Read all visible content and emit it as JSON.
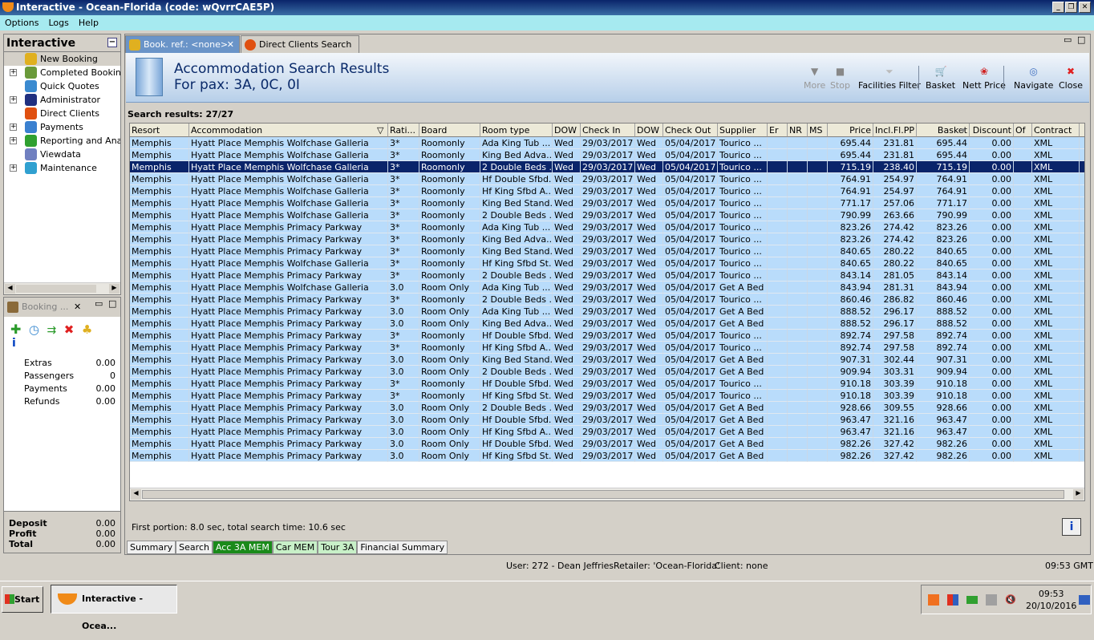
{
  "window": {
    "title": "Interactive - Ocean-Florida (code: wQvrrCAE5P)"
  },
  "menu": [
    "Options",
    "Logs",
    "Help"
  ],
  "sidebar": {
    "title": "Interactive",
    "items": [
      {
        "label": "New Booking",
        "expandable": false,
        "icon": "palm-tree-icon",
        "color": "#e0b020"
      },
      {
        "label": "Completed Bookings",
        "expandable": true,
        "icon": "palm-money-icon",
        "color": "#6a9a3a"
      },
      {
        "label": "Quick Quotes",
        "expandable": false,
        "icon": "clock-icon",
        "color": "#3a8ad0"
      },
      {
        "label": "Administrator",
        "expandable": true,
        "icon": "runner-icon",
        "color": "#203080"
      },
      {
        "label": "Direct Clients",
        "expandable": false,
        "icon": "client-icon",
        "color": "#e05010"
      },
      {
        "label": "Payments",
        "expandable": true,
        "icon": "payment-card-icon",
        "color": "#3a80d0"
      },
      {
        "label": "Reporting and Analyt",
        "expandable": true,
        "icon": "report-icon",
        "color": "#30a030"
      },
      {
        "label": "Viewdata",
        "expandable": false,
        "icon": "globe-icon",
        "color": "#7080c0"
      },
      {
        "label": "Maintenance",
        "expandable": true,
        "icon": "toolbox-icon",
        "color": "#30a0d0"
      }
    ]
  },
  "booking": {
    "title": "Booking ...",
    "info": "i",
    "items": [
      {
        "label": "Extras",
        "value": "0.00"
      },
      {
        "label": "Passengers",
        "value": "0"
      },
      {
        "label": "Payments",
        "value": "0.00"
      },
      {
        "label": "Refunds",
        "value": "0.00"
      }
    ],
    "totals": [
      {
        "label": "Deposit",
        "value": "0.00"
      },
      {
        "label": "Profit",
        "value": "0.00"
      },
      {
        "label": "Total",
        "value": "0.00"
      }
    ]
  },
  "tabs": [
    {
      "label": "Book. ref.: <none>",
      "active": true
    },
    {
      "label": "Direct Clients Search",
      "active": false
    }
  ],
  "header": {
    "title": "Accommodation Search Results",
    "subtitle": "For pax: 3A, 0C, 0I"
  },
  "toolbar": [
    {
      "label": "More",
      "disabled": true,
      "icon": "triangle-down-icon"
    },
    {
      "label": "Stop",
      "disabled": true,
      "icon": "stop-icon"
    },
    {
      "label": "Facilities Filter",
      "disabled": false,
      "icon": "funnel-icon"
    },
    {
      "label": "Basket",
      "disabled": false,
      "icon": "basket-icon"
    },
    {
      "label": "Nett Price",
      "disabled": false,
      "icon": "nett-price-icon"
    },
    {
      "label": "Navigate",
      "disabled": false,
      "icon": "compass-icon"
    },
    {
      "label": "Close",
      "disabled": false,
      "icon": "close-x-icon"
    }
  ],
  "results_label": "Search results: 27/27",
  "columns": [
    "Resort",
    "Accommodation",
    "Rati...",
    "Board",
    "Room type",
    "DOW",
    "Check In",
    "DOW",
    "Check Out",
    "Supplier",
    "Er",
    "NR",
    "MS",
    "Price",
    "Incl.Fl.PP",
    "Basket",
    "Discount",
    "Of",
    "Contract"
  ],
  "rows": [
    [
      "Memphis",
      "Hyatt Place Memphis Wolfchase Galleria",
      "3*",
      "Roomonly",
      "Ada King Tub ...",
      "Wed",
      "29/03/2017",
      "Wed",
      "05/04/2017",
      "Tourico ...",
      "",
      "",
      "",
      "695.44",
      "231.81",
      "695.44",
      "0.00",
      "",
      "XML"
    ],
    [
      "Memphis",
      "Hyatt Place Memphis Wolfchase Galleria",
      "3*",
      "Roomonly",
      "King Bed Adva...",
      "Wed",
      "29/03/2017",
      "Wed",
      "05/04/2017",
      "Tourico ...",
      "",
      "",
      "",
      "695.44",
      "231.81",
      "695.44",
      "0.00",
      "",
      "XML"
    ],
    [
      "Memphis",
      "Hyatt Place Memphis Wolfchase Galleria",
      "3*",
      "Roomonly",
      "2 Double Beds ...",
      "Wed",
      "29/03/2017",
      "Wed",
      "05/04/2017",
      "Tourico ...",
      "",
      "",
      "",
      "715.19",
      "238.40",
      "715.19",
      "0.00",
      "",
      "XML"
    ],
    [
      "Memphis",
      "Hyatt Place Memphis Wolfchase Galleria",
      "3*",
      "Roomonly",
      "Hf Double Sfbd...",
      "Wed",
      "29/03/2017",
      "Wed",
      "05/04/2017",
      "Tourico ...",
      "",
      "",
      "",
      "764.91",
      "254.97",
      "764.91",
      "0.00",
      "",
      "XML"
    ],
    [
      "Memphis",
      "Hyatt Place Memphis Wolfchase Galleria",
      "3*",
      "Roomonly",
      "Hf King Sfbd A...",
      "Wed",
      "29/03/2017",
      "Wed",
      "05/04/2017",
      "Tourico ...",
      "",
      "",
      "",
      "764.91",
      "254.97",
      "764.91",
      "0.00",
      "",
      "XML"
    ],
    [
      "Memphis",
      "Hyatt Place Memphis Wolfchase Galleria",
      "3*",
      "Roomonly",
      "King Bed Stand...",
      "Wed",
      "29/03/2017",
      "Wed",
      "05/04/2017",
      "Tourico ...",
      "",
      "",
      "",
      "771.17",
      "257.06",
      "771.17",
      "0.00",
      "",
      "XML"
    ],
    [
      "Memphis",
      "Hyatt Place Memphis Wolfchase Galleria",
      "3*",
      "Roomonly",
      "2 Double Beds ...",
      "Wed",
      "29/03/2017",
      "Wed",
      "05/04/2017",
      "Tourico ...",
      "",
      "",
      "",
      "790.99",
      "263.66",
      "790.99",
      "0.00",
      "",
      "XML"
    ],
    [
      "Memphis",
      "Hyatt Place Memphis Primacy Parkway",
      "3*",
      "Roomonly",
      "Ada King Tub ...",
      "Wed",
      "29/03/2017",
      "Wed",
      "05/04/2017",
      "Tourico ...",
      "",
      "",
      "",
      "823.26",
      "274.42",
      "823.26",
      "0.00",
      "",
      "XML"
    ],
    [
      "Memphis",
      "Hyatt Place Memphis Primacy Parkway",
      "3*",
      "Roomonly",
      "King Bed Adva...",
      "Wed",
      "29/03/2017",
      "Wed",
      "05/04/2017",
      "Tourico ...",
      "",
      "",
      "",
      "823.26",
      "274.42",
      "823.26",
      "0.00",
      "",
      "XML"
    ],
    [
      "Memphis",
      "Hyatt Place Memphis Primacy Parkway",
      "3*",
      "Roomonly",
      "King Bed Stand...",
      "Wed",
      "29/03/2017",
      "Wed",
      "05/04/2017",
      "Tourico ...",
      "",
      "",
      "",
      "840.65",
      "280.22",
      "840.65",
      "0.00",
      "",
      "XML"
    ],
    [
      "Memphis",
      "Hyatt Place Memphis Wolfchase Galleria",
      "3*",
      "Roomonly",
      "Hf King Sfbd St...",
      "Wed",
      "29/03/2017",
      "Wed",
      "05/04/2017",
      "Tourico ...",
      "",
      "",
      "",
      "840.65",
      "280.22",
      "840.65",
      "0.00",
      "",
      "XML"
    ],
    [
      "Memphis",
      "Hyatt Place Memphis Primacy Parkway",
      "3*",
      "Roomonly",
      "2 Double Beds ...",
      "Wed",
      "29/03/2017",
      "Wed",
      "05/04/2017",
      "Tourico ...",
      "",
      "",
      "",
      "843.14",
      "281.05",
      "843.14",
      "0.00",
      "",
      "XML"
    ],
    [
      "Memphis",
      "Hyatt Place Memphis Wolfchase Galleria",
      "3.0",
      "Room Only",
      "Ada King Tub ...",
      "Wed",
      "29/03/2017",
      "Wed",
      "05/04/2017",
      "Get A Bed",
      "",
      "",
      "",
      "843.94",
      "281.31",
      "843.94",
      "0.00",
      "",
      "XML"
    ],
    [
      "Memphis",
      "Hyatt Place Memphis Primacy Parkway",
      "3*",
      "Roomonly",
      "2 Double Beds ...",
      "Wed",
      "29/03/2017",
      "Wed",
      "05/04/2017",
      "Tourico ...",
      "",
      "",
      "",
      "860.46",
      "286.82",
      "860.46",
      "0.00",
      "",
      "XML"
    ],
    [
      "Memphis",
      "Hyatt Place Memphis Primacy Parkway",
      "3.0",
      "Room Only",
      "Ada King Tub ...",
      "Wed",
      "29/03/2017",
      "Wed",
      "05/04/2017",
      "Get A Bed",
      "",
      "",
      "",
      "888.52",
      "296.17",
      "888.52",
      "0.00",
      "",
      "XML"
    ],
    [
      "Memphis",
      "Hyatt Place Memphis Primacy Parkway",
      "3.0",
      "Room Only",
      "King Bed Adva...",
      "Wed",
      "29/03/2017",
      "Wed",
      "05/04/2017",
      "Get A Bed",
      "",
      "",
      "",
      "888.52",
      "296.17",
      "888.52",
      "0.00",
      "",
      "XML"
    ],
    [
      "Memphis",
      "Hyatt Place Memphis Primacy Parkway",
      "3*",
      "Roomonly",
      "Hf Double Sfbd...",
      "Wed",
      "29/03/2017",
      "Wed",
      "05/04/2017",
      "Tourico ...",
      "",
      "",
      "",
      "892.74",
      "297.58",
      "892.74",
      "0.00",
      "",
      "XML"
    ],
    [
      "Memphis",
      "Hyatt Place Memphis Primacy Parkway",
      "3*",
      "Roomonly",
      "Hf King Sfbd A...",
      "Wed",
      "29/03/2017",
      "Wed",
      "05/04/2017",
      "Tourico ...",
      "",
      "",
      "",
      "892.74",
      "297.58",
      "892.74",
      "0.00",
      "",
      "XML"
    ],
    [
      "Memphis",
      "Hyatt Place Memphis Primacy Parkway",
      "3.0",
      "Room Only",
      "King Bed Stand...",
      "Wed",
      "29/03/2017",
      "Wed",
      "05/04/2017",
      "Get A Bed",
      "",
      "",
      "",
      "907.31",
      "302.44",
      "907.31",
      "0.00",
      "",
      "XML"
    ],
    [
      "Memphis",
      "Hyatt Place Memphis Primacy Parkway",
      "3.0",
      "Room Only",
      "2 Double Beds ...",
      "Wed",
      "29/03/2017",
      "Wed",
      "05/04/2017",
      "Get A Bed",
      "",
      "",
      "",
      "909.94",
      "303.31",
      "909.94",
      "0.00",
      "",
      "XML"
    ],
    [
      "Memphis",
      "Hyatt Place Memphis Primacy Parkway",
      "3*",
      "Roomonly",
      "Hf Double Sfbd...",
      "Wed",
      "29/03/2017",
      "Wed",
      "05/04/2017",
      "Tourico ...",
      "",
      "",
      "",
      "910.18",
      "303.39",
      "910.18",
      "0.00",
      "",
      "XML"
    ],
    [
      "Memphis",
      "Hyatt Place Memphis Primacy Parkway",
      "3*",
      "Roomonly",
      "Hf King Sfbd St...",
      "Wed",
      "29/03/2017",
      "Wed",
      "05/04/2017",
      "Tourico ...",
      "",
      "",
      "",
      "910.18",
      "303.39",
      "910.18",
      "0.00",
      "",
      "XML"
    ],
    [
      "Memphis",
      "Hyatt Place Memphis Primacy Parkway",
      "3.0",
      "Room Only",
      "2 Double Beds ...",
      "Wed",
      "29/03/2017",
      "Wed",
      "05/04/2017",
      "Get A Bed",
      "",
      "",
      "",
      "928.66",
      "309.55",
      "928.66",
      "0.00",
      "",
      "XML"
    ],
    [
      "Memphis",
      "Hyatt Place Memphis Primacy Parkway",
      "3.0",
      "Room Only",
      "Hf Double Sfbd...",
      "Wed",
      "29/03/2017",
      "Wed",
      "05/04/2017",
      "Get A Bed",
      "",
      "",
      "",
      "963.47",
      "321.16",
      "963.47",
      "0.00",
      "",
      "XML"
    ],
    [
      "Memphis",
      "Hyatt Place Memphis Primacy Parkway",
      "3.0",
      "Room Only",
      "Hf King Sfbd A...",
      "Wed",
      "29/03/2017",
      "Wed",
      "05/04/2017",
      "Get A Bed",
      "",
      "",
      "",
      "963.47",
      "321.16",
      "963.47",
      "0.00",
      "",
      "XML"
    ],
    [
      "Memphis",
      "Hyatt Place Memphis Primacy Parkway",
      "3.0",
      "Room Only",
      "Hf Double Sfbd...",
      "Wed",
      "29/03/2017",
      "Wed",
      "05/04/2017",
      "Get A Bed",
      "",
      "",
      "",
      "982.26",
      "327.42",
      "982.26",
      "0.00",
      "",
      "XML"
    ],
    [
      "Memphis",
      "Hyatt Place Memphis Primacy Parkway",
      "3.0",
      "Room Only",
      "Hf King Sfbd St...",
      "Wed",
      "29/03/2017",
      "Wed",
      "05/04/2017",
      "Get A Bed",
      "",
      "",
      "",
      "982.26",
      "327.42",
      "982.26",
      "0.00",
      "",
      "XML"
    ]
  ],
  "selected_row": 2,
  "footer_text": "First portion: 8.0 sec, total search time: 10.6 sec",
  "info_button": "i",
  "bottom_tabs": [
    {
      "label": "Summary",
      "style": "normal"
    },
    {
      "label": "Search",
      "style": "normal"
    },
    {
      "label": "Acc 3A MEM",
      "style": "green"
    },
    {
      "label": "Car MEM",
      "style": "lightgreen"
    },
    {
      "label": "Tour 3A",
      "style": "lightgreen"
    },
    {
      "label": "Financial Summary",
      "style": "normal"
    }
  ],
  "status": {
    "user": "User: 272 - Dean Jeffries",
    "retailer": "Retailer: 'Ocean-Florida'",
    "client": "Client: none",
    "time": "09:53 GMT"
  },
  "taskbar": {
    "start": "Start",
    "task": "Interactive - Ocea...",
    "clock_time": "09:53",
    "clock_date": "20/10/2016"
  }
}
